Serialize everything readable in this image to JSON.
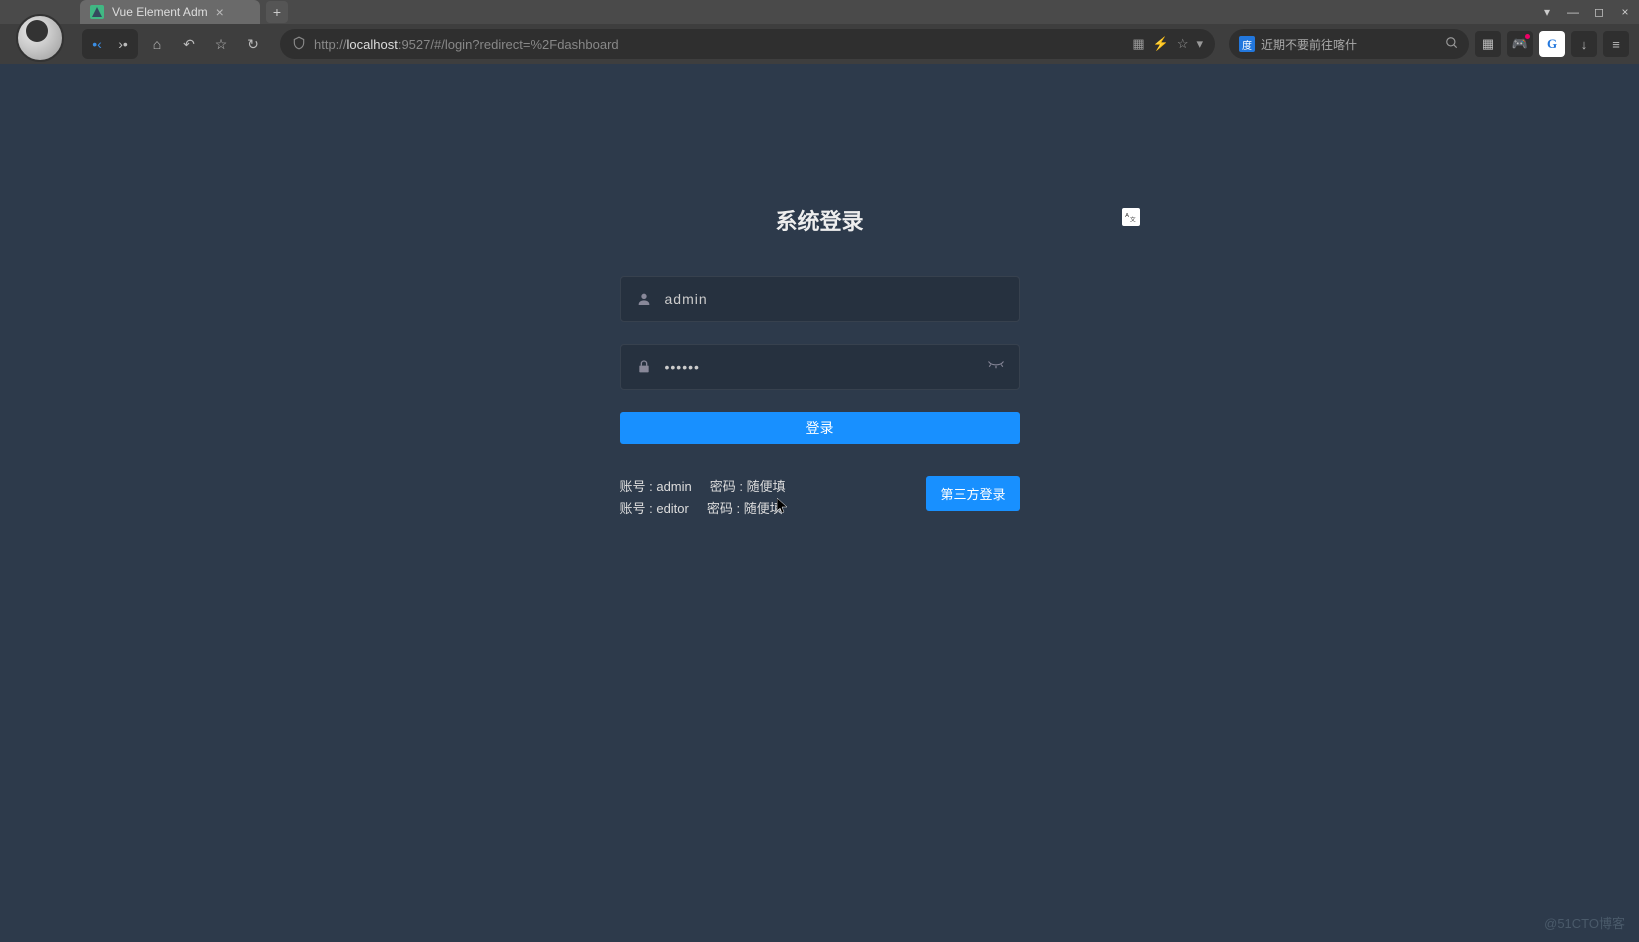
{
  "browser": {
    "tab_title": "Vue Element Adm",
    "url_pre": "http://",
    "url_host": "localhost",
    "url_rest": ":9527/#/login?redirect=%2Fdashboard",
    "search_placeholder": "近期不要前往喀什"
  },
  "login": {
    "title": "系统登录",
    "username": "admin",
    "password": "••••••",
    "login_button": "登录",
    "thirdparty_button": "第三方登录",
    "tip1_account": "账号 : admin",
    "tip1_password": "密码 : 随便填",
    "tip2_account": "账号 : editor",
    "tip2_password": "密码 : 随便填"
  },
  "watermark": "@51CTO博客"
}
